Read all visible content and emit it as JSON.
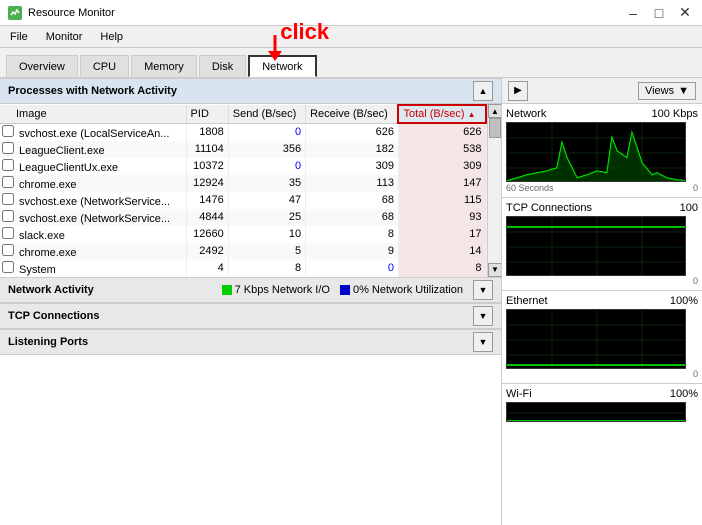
{
  "titleBar": {
    "title": "Resource Monitor",
    "minimizeLabel": "–",
    "maximizeLabel": "□",
    "closeLabel": "✕"
  },
  "menuBar": {
    "items": [
      "File",
      "Monitor",
      "Help"
    ]
  },
  "tabs": [
    {
      "label": "Overview",
      "active": false
    },
    {
      "label": "CPU",
      "active": false
    },
    {
      "label": "Memory",
      "active": false
    },
    {
      "label": "Disk",
      "active": false
    },
    {
      "label": "Network",
      "active": true
    }
  ],
  "processTable": {
    "title": "Processes with Network Activity",
    "columns": [
      "Image",
      "PID",
      "Send (B/sec)",
      "Receive (B/sec)",
      "Total (B/sec)"
    ],
    "rows": [
      {
        "image": "svchost.exe (LocalServiceAn...",
        "pid": "1808",
        "send": "0",
        "receive": "626",
        "total": "626"
      },
      {
        "image": "LeagueClient.exe",
        "pid": "11104",
        "send": "356",
        "receive": "182",
        "total": "538"
      },
      {
        "image": "LeagueClientUx.exe",
        "pid": "10372",
        "send": "0",
        "receive": "309",
        "total": "309"
      },
      {
        "image": "chrome.exe",
        "pid": "12924",
        "send": "35",
        "receive": "113",
        "total": "147"
      },
      {
        "image": "svchost.exe (NetworkService...",
        "pid": "1476",
        "send": "47",
        "receive": "68",
        "total": "115"
      },
      {
        "image": "svchost.exe (NetworkService...",
        "pid": "4844",
        "send": "25",
        "receive": "68",
        "total": "93"
      },
      {
        "image": "slack.exe",
        "pid": "12660",
        "send": "10",
        "receive": "8",
        "total": "17"
      },
      {
        "image": "chrome.exe",
        "pid": "2492",
        "send": "5",
        "receive": "9",
        "total": "14"
      },
      {
        "image": "System",
        "pid": "4",
        "send": "8",
        "receive": "0",
        "total": "8"
      }
    ]
  },
  "networkActivity": {
    "title": "Network Activity",
    "legend1Color": "#00cc00",
    "legend1Label": "7 Kbps Network I/O",
    "legend2Color": "#0000cc",
    "legend2Label": "0% Network Utilization"
  },
  "tcpConnections": {
    "title": "TCP Connections"
  },
  "listeningPorts": {
    "title": "Listening Ports"
  },
  "rightPanel": {
    "navLabel": "▶",
    "viewsLabel": "Views",
    "chevronLabel": "▼",
    "networkGraph": {
      "label": "Network",
      "value": "100 Kbps",
      "timeStart": "60 Seconds",
      "timeEnd": "0"
    },
    "tcpGraph": {
      "label": "TCP Connections",
      "value": "100",
      "timeEnd": "0"
    },
    "ethernetGraph": {
      "label": "Ethernet",
      "value": "100%",
      "timeEnd": "0"
    },
    "wifiGraph": {
      "label": "Wi-Fi",
      "value": "100%"
    }
  },
  "annotation": {
    "clickLabel": "click"
  }
}
